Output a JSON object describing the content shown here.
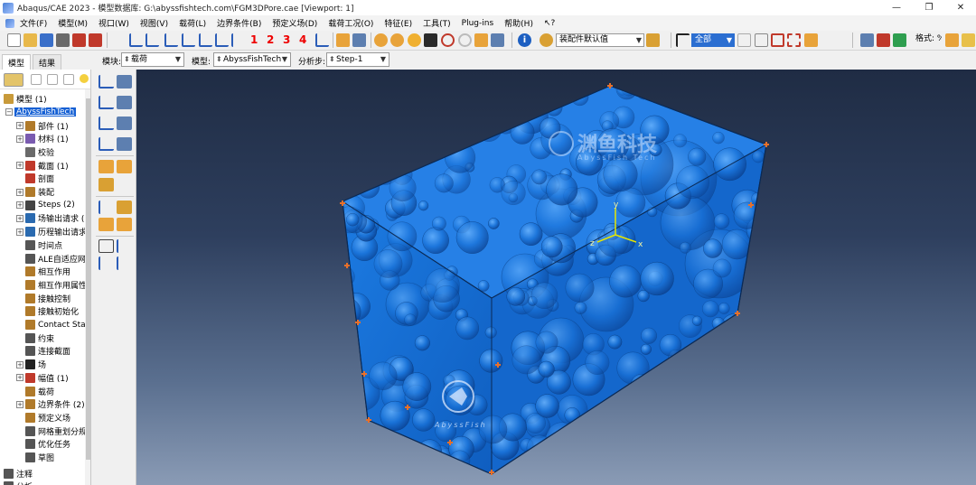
{
  "window": {
    "title": "Abaqus/CAE 2023 - 模型数据库: G:\\abyssfishtech.com\\FGM3DPore.cae [Viewport: 1]",
    "minimize": "—",
    "maximize": "❐",
    "close": "✕",
    "mdi_min": "–",
    "mdi_restore": "❐",
    "mdi_close": "✕"
  },
  "menubar": {
    "items": [
      "文件(F)",
      "模型(M)",
      "视口(W)",
      "视图(V)",
      "载荷(L)",
      "边界条件(B)",
      "预定义场(D)",
      "载荷工况(O)",
      "特征(E)",
      "工具(T)",
      "Plug-ins",
      "帮助(H)",
      "↖?"
    ]
  },
  "toolbar": {
    "csys_numbers": [
      "1",
      "2",
      "3",
      "4"
    ],
    "render_select": "装配件默认值",
    "visibility_select": "全部",
    "format_label": "格式: %s"
  },
  "context": {
    "module_label": "模块:",
    "module_value": "载荷",
    "model_label": "模型:",
    "model_value": "AbyssFishTech",
    "step_label": "分析步:",
    "step_value": "Step-1"
  },
  "tabs": [
    "模型",
    "结果"
  ],
  "tree": {
    "root": "模型 (1)",
    "model_name": "AbyssFishTech",
    "items": [
      {
        "label": "部件 (1)",
        "expandable": true,
        "color": "#b07a2a"
      },
      {
        "label": "材料 (1)",
        "expandable": true,
        "color": "#7a5bb0"
      },
      {
        "label": "校验",
        "expandable": false,
        "color": "#6a6a6a"
      },
      {
        "label": "截面 (1)",
        "expandable": true,
        "color": "#c0392b"
      },
      {
        "label": "剖面",
        "expandable": false,
        "color": "#c0392b"
      },
      {
        "label": "装配",
        "expandable": true,
        "color": "#b07a2a"
      },
      {
        "label": "Steps (2)",
        "expandable": true,
        "color": "#444"
      },
      {
        "label": "场输出请求 (",
        "expandable": true,
        "color": "#2a6ab0"
      },
      {
        "label": "历程输出请求",
        "expandable": true,
        "color": "#2a6ab0"
      },
      {
        "label": "时间点",
        "expandable": false,
        "color": "#555"
      },
      {
        "label": "ALE自适应网",
        "expandable": false,
        "color": "#555"
      },
      {
        "label": "相互作用",
        "expandable": false,
        "color": "#b07a2a"
      },
      {
        "label": "相互作用属性",
        "expandable": false,
        "color": "#b07a2a"
      },
      {
        "label": "接触控制",
        "expandable": false,
        "color": "#b07a2a"
      },
      {
        "label": "接触初始化",
        "expandable": false,
        "color": "#b07a2a"
      },
      {
        "label": "Contact Sta",
        "expandable": false,
        "color": "#b07a2a"
      },
      {
        "label": "约束",
        "expandable": false,
        "color": "#555"
      },
      {
        "label": "连接截面",
        "expandable": false,
        "color": "#555"
      },
      {
        "label": "场",
        "expandable": true,
        "color": "#222"
      },
      {
        "label": "幅值 (1)",
        "expandable": true,
        "color": "#c0392b"
      },
      {
        "label": "载荷",
        "expandable": false,
        "color": "#b07a2a"
      },
      {
        "label": "边界条件 (2)",
        "expandable": true,
        "color": "#b07a2a"
      },
      {
        "label": "预定义场",
        "expandable": false,
        "color": "#b07a2a"
      },
      {
        "label": "网格重划分规",
        "expandable": false,
        "color": "#555"
      },
      {
        "label": "优化任务",
        "expandable": false,
        "color": "#555"
      },
      {
        "label": "草图",
        "expandable": false,
        "color": "#555"
      }
    ],
    "annotation": "注释",
    "analysis": "分析"
  },
  "viewport": {
    "axes": {
      "x": "x",
      "y": "y",
      "z": "z"
    },
    "watermark_cn": "渊鱼科技",
    "watermark_en": "AbyssFish Tech",
    "logo_text": "AbyssFish",
    "colors": {
      "solid": "#1a73d8",
      "edge": "#0b2a55",
      "marker": "#e8702a"
    }
  }
}
